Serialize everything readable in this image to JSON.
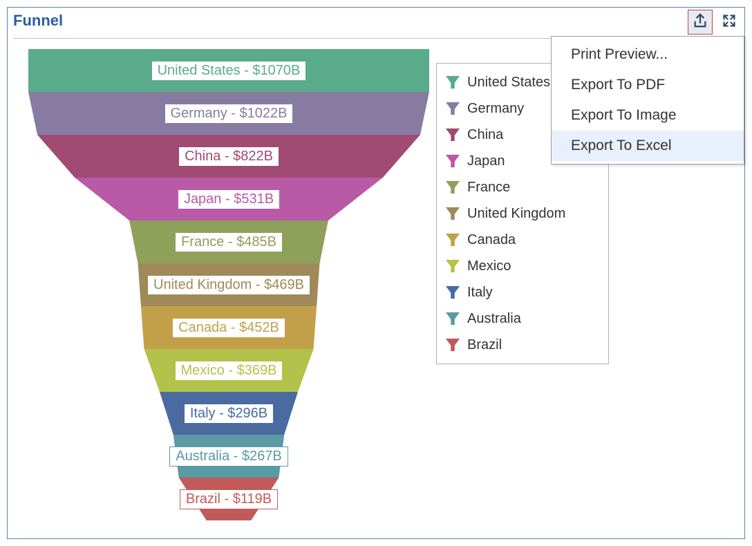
{
  "title": "Funnel",
  "chart_data": {
    "type": "funnel",
    "title": "Funnel",
    "series": [
      {
        "name": "United States",
        "value": 1070,
        "color": "#5aab8b",
        "label": "United States - $1070B"
      },
      {
        "name": "Germany",
        "value": 1022,
        "color": "#877ba1",
        "label": "Germany - $1022B"
      },
      {
        "name": "China",
        "value": 822,
        "color": "#a04a74",
        "label": "China - $822B"
      },
      {
        "name": "Japan",
        "value": 531,
        "color": "#b85aa6",
        "label": "Japan - $531B"
      },
      {
        "name": "France",
        "value": 485,
        "color": "#8fa05a",
        "label": "France - $485B"
      },
      {
        "name": "United Kingdom",
        "value": 469,
        "color": "#a08a5a",
        "label": "United Kingdom - $469B"
      },
      {
        "name": "Canada",
        "value": 452,
        "color": "#c2a04a",
        "label": "Canada - $452B"
      },
      {
        "name": "Mexico",
        "value": 369,
        "color": "#b2c24a",
        "label": "Mexico - $369B"
      },
      {
        "name": "Italy",
        "value": 296,
        "color": "#4a6aa0",
        "label": "Italy - $296B"
      },
      {
        "name": "Australia",
        "value": 267,
        "color": "#5a9aa4",
        "label": "Australia - $267B"
      },
      {
        "name": "Brazil",
        "value": 119,
        "color": "#c25a5a",
        "label": "Brazil - $119B"
      }
    ],
    "value_unit": "$B"
  },
  "menu": {
    "items": [
      {
        "label": "Print Preview..."
      },
      {
        "label": "Export To PDF"
      },
      {
        "label": "Export To Image"
      },
      {
        "label": "Export To Excel",
        "hover": true
      }
    ]
  }
}
